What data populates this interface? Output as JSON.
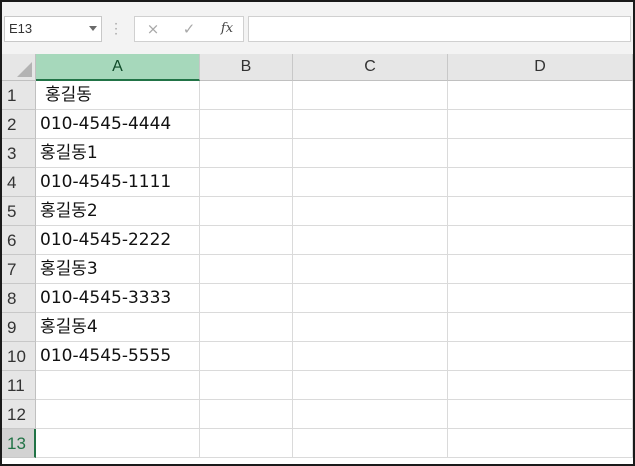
{
  "formula_bar": {
    "name_box": "E13",
    "cancel_icon": "×",
    "enter_icon": "✓",
    "function_icon": "fx",
    "formula": ""
  },
  "columns": [
    "A",
    "B",
    "C",
    "D"
  ],
  "active_column": "A",
  "active_row": "13",
  "rows": [
    {
      "num": "1",
      "a": "홍길동"
    },
    {
      "num": "2",
      "a": "010-4545-4444"
    },
    {
      "num": "3",
      "a": "홍길동1"
    },
    {
      "num": "4",
      "a": "010-4545-1111"
    },
    {
      "num": "5",
      "a": "홍길동2"
    },
    {
      "num": "6",
      "a": "010-4545-2222"
    },
    {
      "num": "7",
      "a": "홍길동3"
    },
    {
      "num": "8",
      "a": "010-4545-3333"
    },
    {
      "num": "9",
      "a": "홍길동4"
    },
    {
      "num": "10",
      "a": "010-4545-5555"
    },
    {
      "num": "11",
      "a": ""
    },
    {
      "num": "12",
      "a": ""
    },
    {
      "num": "13",
      "a": ""
    }
  ],
  "colors": {
    "accent": "#217346",
    "active_header": "#a6d8bb",
    "header_bg": "#e6e6e6"
  }
}
